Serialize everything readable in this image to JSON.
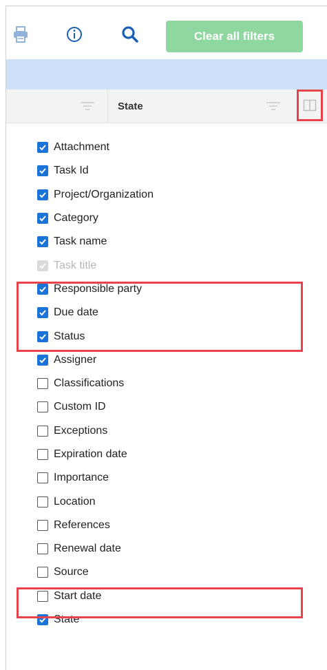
{
  "toolbar": {
    "clear_filters_label": "Clear all filters",
    "icons": [
      "print-icon",
      "info-icon",
      "search-icon"
    ],
    "accent": "#8ed7a0"
  },
  "table_header": {
    "state_label": "State",
    "band_color": "#cde2f8"
  },
  "columns": [
    {
      "label": "Attachment",
      "checked": true,
      "disabled": false
    },
    {
      "label": "Task Id",
      "checked": true,
      "disabled": false
    },
    {
      "label": "Project/Organization",
      "checked": true,
      "disabled": false
    },
    {
      "label": "Category",
      "checked": true,
      "disabled": false
    },
    {
      "label": "Task name",
      "checked": true,
      "disabled": false
    },
    {
      "label": "Task title",
      "checked": true,
      "disabled": true
    },
    {
      "label": "Responsible party",
      "checked": true,
      "disabled": false
    },
    {
      "label": "Due date",
      "checked": true,
      "disabled": false
    },
    {
      "label": "Status",
      "checked": true,
      "disabled": false
    },
    {
      "label": "Assigner",
      "checked": true,
      "disabled": false
    },
    {
      "label": "Classifications",
      "checked": false,
      "disabled": false
    },
    {
      "label": "Custom ID",
      "checked": false,
      "disabled": false
    },
    {
      "label": "Exceptions",
      "checked": false,
      "disabled": false
    },
    {
      "label": "Expiration date",
      "checked": false,
      "disabled": false
    },
    {
      "label": "Importance",
      "checked": false,
      "disabled": false
    },
    {
      "label": "Location",
      "checked": false,
      "disabled": false
    },
    {
      "label": "References",
      "checked": false,
      "disabled": false
    },
    {
      "label": "Renewal date",
      "checked": false,
      "disabled": false
    },
    {
      "label": "Source",
      "checked": false,
      "disabled": false
    },
    {
      "label": "Start date",
      "checked": false,
      "disabled": false
    },
    {
      "label": "State",
      "checked": true,
      "disabled": false
    }
  ],
  "colors": {
    "checkbox_on": "#1a73d6",
    "highlight": "#e8434a"
  }
}
